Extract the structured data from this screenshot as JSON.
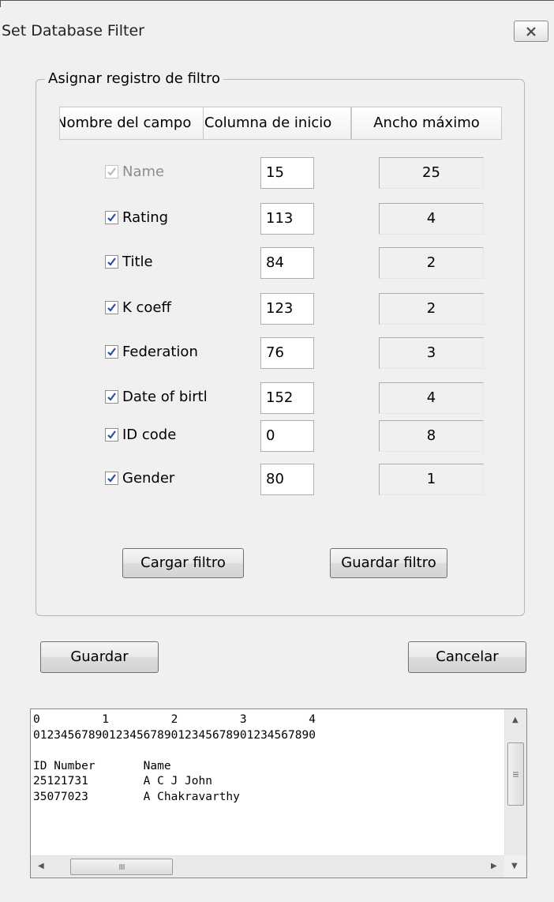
{
  "window": {
    "title": "Set Database Filter"
  },
  "group": {
    "legend": "Asignar registro de filtro"
  },
  "columns": {
    "field_name": "Nombre del campo",
    "start_column": "Columna de inicio",
    "max_width": "Ancho máximo"
  },
  "fields": [
    {
      "label": "Name",
      "start": "15",
      "width": "25",
      "checked": true,
      "disabled": true
    },
    {
      "label": "Rating",
      "start": "113",
      "width": "4",
      "checked": true,
      "disabled": false
    },
    {
      "label": "Title",
      "start": "84",
      "width": "2",
      "checked": true,
      "disabled": false
    },
    {
      "label": "K coeff",
      "start": "123",
      "width": "2",
      "checked": true,
      "disabled": false
    },
    {
      "label": "Federation",
      "start": "76",
      "width": "3",
      "checked": true,
      "disabled": false
    },
    {
      "label": "Date of birth",
      "start": "152",
      "width": "4",
      "checked": true,
      "disabled": false
    },
    {
      "label": "ID code",
      "start": "0",
      "width": "8",
      "checked": true,
      "disabled": false
    },
    {
      "label": "Gender",
      "start": "80",
      "width": "1",
      "checked": true,
      "disabled": false
    }
  ],
  "buttons": {
    "load_filter": "Cargar filtro",
    "save_filter": "Guardar filtro",
    "save": "Guardar",
    "cancel": "Cancelar"
  },
  "preview": {
    "lines": [
      "0         1         2         3         4",
      "01234567890123456789012345678901234567890",
      "",
      "ID Number       Name",
      "25121731        A C J John",
      "35077023        A Chakravarthy"
    ]
  }
}
